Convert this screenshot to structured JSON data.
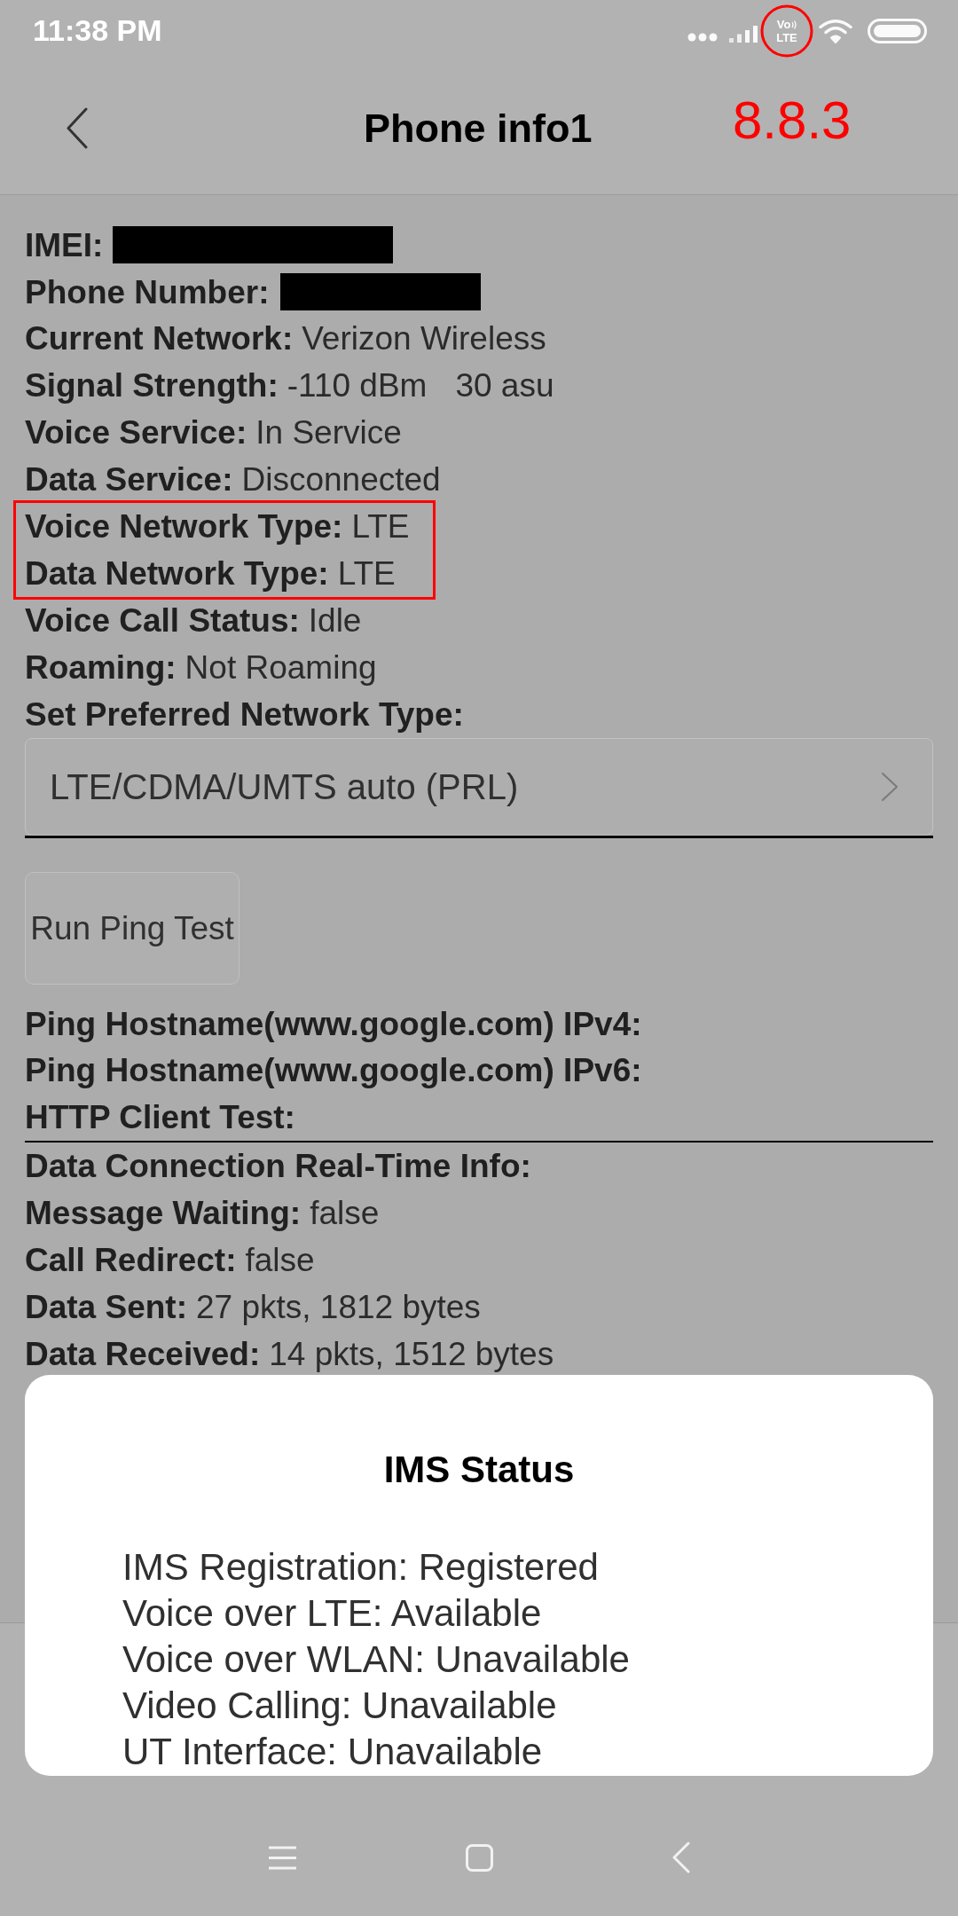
{
  "status_bar": {
    "time": "11:38 PM",
    "volte_badge": {
      "lines": [
        "Vo",
        "LTE"
      ],
      "circled": true
    }
  },
  "header": {
    "title": "Phone info1",
    "note": "8.8.3"
  },
  "info_rows": [
    {
      "kind": "redacted",
      "label": "IMEI:",
      "highlighted": false
    },
    {
      "kind": "redacted",
      "label": "Phone Number:",
      "highlighted": false
    },
    {
      "kind": "pair",
      "label": "Current Network:",
      "values": [
        "Verizon Wireless"
      ],
      "highlighted": false
    },
    {
      "kind": "pair",
      "label": "Signal Strength:",
      "values": [
        "-110 dBm",
        "30 asu"
      ],
      "highlighted": false
    },
    {
      "kind": "pair",
      "label": "Voice Service:",
      "values": [
        "In Service"
      ],
      "highlighted": false
    },
    {
      "kind": "pair",
      "label": "Data Service:",
      "values": [
        "Disconnected"
      ],
      "highlighted": false
    },
    {
      "kind": "pair",
      "label": "Voice Network Type:",
      "values": [
        "LTE"
      ],
      "highlighted": true
    },
    {
      "kind": "pair",
      "label": "Data Network Type:",
      "values": [
        "LTE"
      ],
      "highlighted": true
    },
    {
      "kind": "pair",
      "label": "Voice Call Status:",
      "values": [
        "Idle"
      ],
      "highlighted": false
    },
    {
      "kind": "pair",
      "label": "Roaming:",
      "values": [
        "Not Roaming"
      ],
      "highlighted": false
    },
    {
      "kind": "heading",
      "label": "Set Preferred Network Type:",
      "highlighted": false
    }
  ],
  "network_type_select": {
    "value": "LTE/CDMA/UMTS auto (PRL)"
  },
  "ping_button": {
    "label": "Run Ping Test"
  },
  "test_rows": [
    {
      "kind": "heading",
      "label": "Ping Hostname(www.google.com) IPv4:"
    },
    {
      "kind": "heading",
      "label": "Ping Hostname(www.google.com) IPv6:"
    },
    {
      "kind": "heading",
      "label": "HTTP Client Test:"
    }
  ],
  "realtime_rows": [
    {
      "kind": "heading",
      "label": "Data Connection Real-Time Info:"
    },
    {
      "kind": "pair",
      "label": "Message Waiting:",
      "values": [
        "false"
      ]
    },
    {
      "kind": "pair",
      "label": "Call Redirect:",
      "values": [
        "false"
      ]
    },
    {
      "kind": "pair",
      "label": "Data Sent:",
      "values": [
        "27 pkts, 1812 bytes"
      ]
    },
    {
      "kind": "pair",
      "label": "Data Received:",
      "values": [
        "14 pkts, 1512 bytes"
      ]
    }
  ],
  "dialog": {
    "title": "IMS Status",
    "lines": [
      "IMS Registration: Registered",
      "Voice over LTE: Available",
      "Voice over WLAN: Unavailable",
      "Video Calling: Unavailable",
      "UT Interface: Unavailable"
    ]
  }
}
